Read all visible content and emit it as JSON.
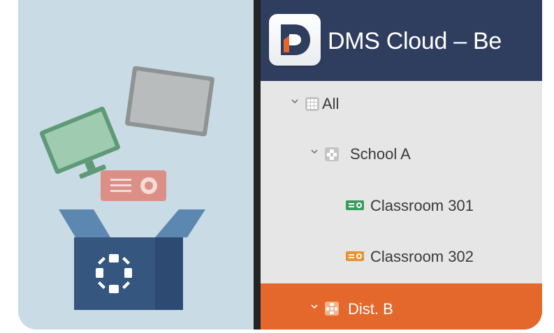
{
  "app": {
    "title": "DMS Cloud – Be",
    "logo_letter": "D"
  },
  "tree": {
    "items": [
      {
        "label": "All",
        "icon": "grid-icon",
        "expanded": true,
        "selected": false
      },
      {
        "label": "School A",
        "icon": "school-icon",
        "expanded": true,
        "selected": false
      },
      {
        "label": "Classroom 301",
        "icon": "projector-icon",
        "icon_color": "#3a9b5a",
        "selected": false
      },
      {
        "label": "Classroom 302",
        "icon": "projector-icon",
        "icon_color": "#e8922e",
        "selected": false
      },
      {
        "label": "Dist. B",
        "icon": "district-icon",
        "expanded": true,
        "selected": true
      }
    ]
  },
  "colors": {
    "header": "#2f3d5e",
    "selected_row": "#e4682b",
    "illustration_bg": "#c9dbe5"
  }
}
